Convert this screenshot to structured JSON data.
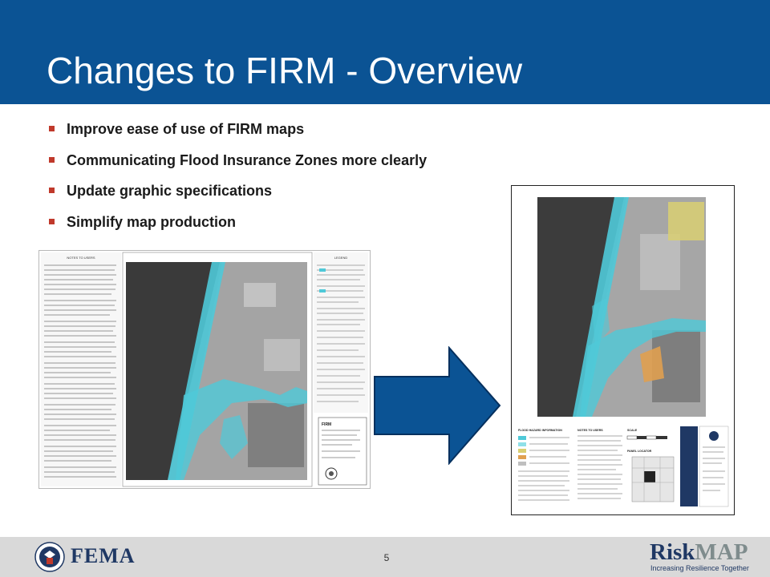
{
  "slide": {
    "title": "Changes to FIRM - Overview",
    "bullets": [
      "Improve ease of use of FIRM maps",
      "Communicating Flood Insurance Zones more clearly",
      "Update graphic specifications",
      "Simplify map production"
    ]
  },
  "maps": {
    "old_firm": {
      "notes_heading": "NOTES TO USERS",
      "legend_heading": "LEGEND",
      "title_block": "FIRM"
    },
    "new_firm": {
      "flood_hazard_heading": "FLOOD HAZARD INFORMATION",
      "notes_heading": "NOTES TO USERS",
      "scale_heading": "SCALE",
      "panel_locator_heading": "PANEL LOCATOR"
    }
  },
  "footer": {
    "agency": "FEMA",
    "page_number": "5",
    "brand_part1": "Risk",
    "brand_part2": "MAP",
    "tagline": "Increasing Resilience Together"
  },
  "colors": {
    "header_blue": "#0b5394",
    "arrow_blue": "#0b5394",
    "bullet_red": "#c0392b",
    "flood_zone_cyan": "#4fc9d8",
    "footer_gray": "#d9d9d9"
  }
}
